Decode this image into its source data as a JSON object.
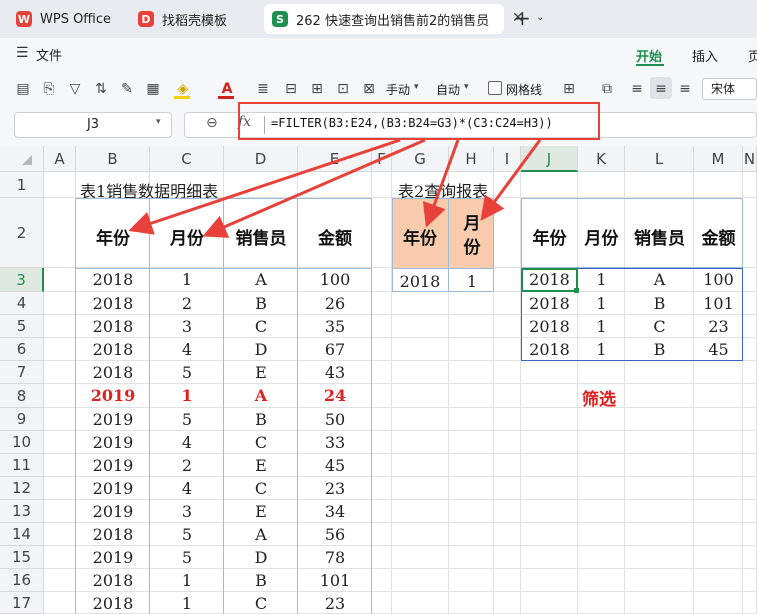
{
  "tabs": [
    {
      "label": "WPS Office",
      "icon": "wps-logo-icon"
    },
    {
      "label": "找稻壳模板",
      "icon": "docer-logo-icon"
    },
    {
      "label": "262 快速查询出销售前2的销售员",
      "icon": "spreadsheet-s-icon"
    }
  ],
  "menu": {
    "file_label": "文件",
    "tabs": [
      "开始",
      "插入",
      "页"
    ]
  },
  "toolbar": {
    "manual_label": "手动",
    "auto_label": "自动",
    "gridlines_label": "网格线",
    "font_name": "宋体"
  },
  "formula_bar": {
    "cell_ref": "J3",
    "fx": "fx",
    "formula": "=FILTER(B3:E24,(B3:B24=G3)*(C3:C24=H3))"
  },
  "columns": [
    "A",
    "B",
    "C",
    "D",
    "E",
    "F",
    "G",
    "H",
    "I",
    "J",
    "K",
    "L",
    "M",
    "N"
  ],
  "rows": [
    "1",
    "2",
    "3",
    "4",
    "5",
    "6",
    "7",
    "8",
    "9",
    "10",
    "11",
    "12",
    "13",
    "14",
    "15",
    "16",
    "17"
  ],
  "table1": {
    "title": "表1销售数据明细表",
    "headers": [
      "年份",
      "月份",
      "销售员",
      "金额"
    ],
    "rows": [
      [
        "2018",
        "1",
        "A",
        "100"
      ],
      [
        "2018",
        "2",
        "B",
        "26"
      ],
      [
        "2018",
        "3",
        "C",
        "35"
      ],
      [
        "2018",
        "4",
        "D",
        "67"
      ],
      [
        "2018",
        "5",
        "E",
        "43"
      ],
      [
        "2019",
        "1",
        "A",
        "24"
      ],
      [
        "2019",
        "5",
        "B",
        "50"
      ],
      [
        "2019",
        "4",
        "C",
        "33"
      ],
      [
        "2019",
        "2",
        "E",
        "45"
      ],
      [
        "2019",
        "4",
        "C",
        "23"
      ],
      [
        "2019",
        "3",
        "E",
        "34"
      ],
      [
        "2018",
        "5",
        "A",
        "56"
      ],
      [
        "2019",
        "5",
        "D",
        "78"
      ],
      [
        "2018",
        "1",
        "B",
        "101"
      ],
      [
        "2018",
        "1",
        "C",
        "23"
      ]
    ],
    "highlight_row_index": 5,
    "highlight_color": "#e02020"
  },
  "table2": {
    "title": "表2查询报表",
    "headers": [
      "年份",
      "月份"
    ],
    "values": [
      "2018",
      "1"
    ],
    "header_bg": "#f8cbad"
  },
  "result": {
    "headers": [
      "年份",
      "月份",
      "销售员",
      "金额"
    ],
    "rows": [
      [
        "2018",
        "1",
        "A",
        "100"
      ],
      [
        "2018",
        "1",
        "B",
        "101"
      ],
      [
        "2018",
        "1",
        "C",
        "23"
      ],
      [
        "2018",
        "1",
        "B",
        "45"
      ]
    ],
    "label": "筛选"
  },
  "colors": {
    "accent_green": "#1e8f4e",
    "annotation_red": "#e8413a",
    "table_border": "#9bbbd9",
    "result_border": "#3a62c7"
  }
}
